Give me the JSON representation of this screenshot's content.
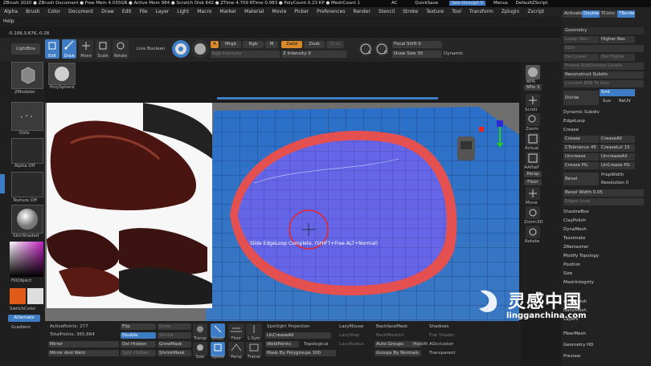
{
  "titlebar": {
    "text": "ZBrush 2020 ● ZBrush Document   ● Free Mem 4.035GB ● Active Mem 984 ● Scratch Disk 642 ● ZTime 4.709 RTime 0.983 ● PolyCount 0.23 KP ● MeshCount 1",
    "ac": "AC",
    "quicksave": "QuickSave",
    "seethrough": "See-through 0",
    "menus": "Menus",
    "default": "DefaultZScript"
  },
  "menus": [
    "Alpha",
    "Brush",
    "Color",
    "Document",
    "Draw",
    "Edit",
    "File",
    "Layer",
    "Light",
    "Macro",
    "Marker",
    "Material",
    "Movie",
    "Picker",
    "Preferences",
    "Render",
    "Stencil",
    "Stroke",
    "Texture",
    "Tool",
    "Transform",
    "Zplugin",
    "Zscript"
  ],
  "help": "Help",
  "coords": "-0.106,3.676,-0.28",
  "topshelf": {
    "lightbox": "LightBox",
    "edit": "Edit",
    "draw": "Draw",
    "move": "Move",
    "scale": "Scale",
    "rotate": "Rotate",
    "liveboolean": "Live Boolean",
    "a": "A",
    "mrgb": "Mrgb",
    "rgb": "Rgb",
    "m": "M",
    "zadd": "Zadd",
    "zsub": "Zsub",
    "zcut": "Zcut",
    "rgbintensity": "Rgb Intensity",
    "zintensity": "Z Intensity 0",
    "focalshift": "Focal Shift 0",
    "drawsize": "Draw Size 30",
    "dynamic": "Dynamic",
    "s": "S",
    "d": "D"
  },
  "leftpanel": {
    "zmodeler": "ZModeler",
    "polysphere": "PolySphere",
    "dots": "Dots",
    "alphaoff": "Alpha Off",
    "textureoff": "Texture Off",
    "skinshaded": "SkinShaded",
    "fillobject": "FillObject",
    "switchcolor": "SwitchColor",
    "alternate": "Alternate",
    "gradient": "Gradient"
  },
  "rightshelf": {
    "bpr": "BPR",
    "spix": "SPix 3",
    "scroll": "Scroll",
    "zoom": "Zoom",
    "actual": "Actual",
    "aahalf": "AAHalf",
    "persp": "Persp",
    "floor": "Floor",
    "move": "Move",
    "zoom3d": "Zoom3D",
    "rotate": "Rotate"
  },
  "rightpanel": {
    "tabs": [
      "Activate",
      "Double",
      "TConv",
      "TBorde"
    ],
    "geometry": "Geometry",
    "lowerres": "Lower Res",
    "higherres": "Higher Res",
    "sdiv": "SDiv",
    "dellower": "Del Lower",
    "delhigher": "Del Higher",
    "freezesubdiv": "Freeze SubDivision Levels",
    "reconstruct": "Reconstruct Subdiv",
    "convertbpr": "Convert BPR To Geo",
    "divide": "Divide",
    "smt": "Smt",
    "suv": "Suv",
    "reuv": "ReUV",
    "dynamicsubdiv": "Dynamic Subdiv",
    "edgeloop": "EdgeLoop",
    "crease": "Crease",
    "creasebtn": "Crease",
    "creaseall": "CreaseAll",
    "ctolerance": "CTolerance 45",
    "creaselvl": "CreaseLvl 15",
    "uncrease": "Uncrease",
    "uncreaseall": "UncreaseAll",
    "creasepg": "Crease PG",
    "uncreasepg": "UnCrease PG",
    "bevel": "Bevel",
    "propwidth": "PropWidth",
    "resolution": "Resolution 0",
    "bevelwidth": "Bevel Width 0.05",
    "edgesloop": "Edges Loop",
    "sections": [
      "ShadowBox",
      "ClayPolish",
      "DynaMesh",
      "Tessimate",
      "ZRemesher",
      "Modify Topology",
      "Position",
      "Size",
      "MeshIntegrity"
    ],
    "lower": [
      "ArrayMesh",
      "NanoMesh",
      "Layers",
      "FiberMesh",
      "Geometry HD",
      "Preview"
    ]
  },
  "viewport": {
    "tooltip": "Slide EdgeLoop Complete. (SHIFT+Free ALT+Normal)"
  },
  "bottombar": {
    "activepoints": "ActivePoints: 277",
    "totalpoints": "TotalPoints: 365,664",
    "mirror": "Mirror",
    "mirrorandweld": "Mirror And Weld",
    "flip": "Flip",
    "double": "Double",
    "delhidden": "Del Hidden",
    "splithidden": "Split Hidden",
    "grow": "Grow",
    "shrink": "Shrink",
    "growmask": "GrowMask",
    "shrinkmask": "ShrinkMask",
    "transp": "Transp",
    "ghost": "Ghost",
    "solo": "Solo",
    "xpose": "Xpose",
    "floor": "Floor",
    "lsym": "L.Sym",
    "persp": "Persp",
    "frame": "Frame",
    "spotlightprojection": "Spotlight Projection",
    "uncreaseall": "UnCreaseAll",
    "weldpoints": "WeldPoints",
    "topological": "Topological",
    "maskbypolygroups": "Mask By Polygroups 100",
    "lazymouse": "LazyMouse",
    "lazystep": "LazyStep",
    "lazyradius": "LazyRadius",
    "backfacemask": "BackfaceMask",
    "backmaskint": "BackMaskInt",
    "autogroups": "Auto Groups",
    "groupsbynormals": "Groups By Normals",
    "maskrt": "MaskRt",
    "shadows": "Shadows",
    "flatshader": "Flat Shader",
    "aocclusion": "AOcclusion",
    "transparent": "Transparent"
  },
  "watermark": {
    "brand": "灵感中国",
    "url": "lingganchina.com"
  }
}
